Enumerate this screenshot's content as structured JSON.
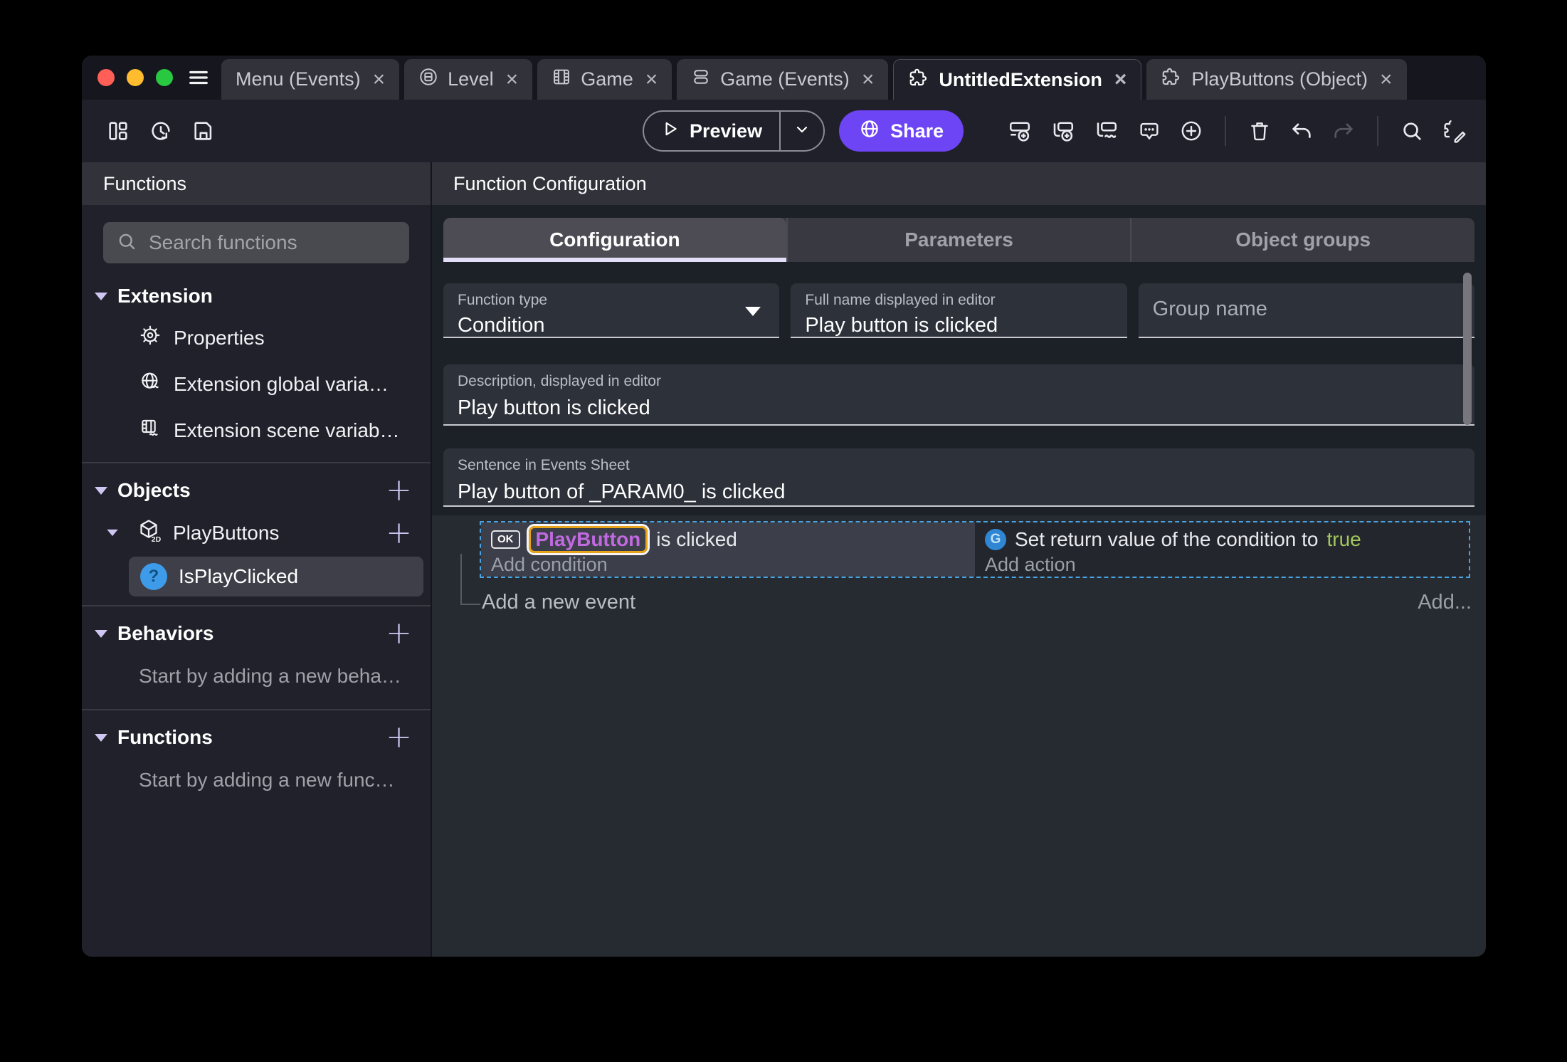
{
  "close_glyph": "×",
  "tabs": [
    {
      "label": "Menu (Events)"
    },
    {
      "label": "Level"
    },
    {
      "label": "Game"
    },
    {
      "label": "Game (Events)"
    },
    {
      "label": "UntitledExtension"
    },
    {
      "label": "PlayButtons (Object)"
    }
  ],
  "toolbar": {
    "preview": "Preview",
    "share": "Share"
  },
  "sidebar": {
    "title": "Functions",
    "search_placeholder": "Search functions",
    "extension_section": {
      "title": "Extension",
      "items": [
        "Properties",
        "Extension global varia…",
        "Extension scene variab…"
      ]
    },
    "objects_section": {
      "title": "Objects",
      "object_name": "PlayButtons",
      "function_name": "IsPlayClicked"
    },
    "behaviors_section": {
      "title": "Behaviors",
      "hint": "Start by adding a new beha…"
    },
    "functions_section": {
      "title": "Functions",
      "hint": "Start by adding a new func…"
    }
  },
  "main": {
    "title": "Function Configuration",
    "tabs": [
      {
        "label": "Configuration"
      },
      {
        "label": "Parameters"
      },
      {
        "label": "Object groups"
      }
    ],
    "function_type_label": "Function type",
    "function_type_value": "Condition",
    "full_name_label": "Full name displayed in editor",
    "full_name_value": "Play button is clicked",
    "group_name_placeholder": "Group name",
    "description_label": "Description, displayed in editor",
    "description_value": "Play button is clicked",
    "sentence_label": "Sentence in Events Sheet",
    "sentence_value": "Play button of _PARAM0_ is clicked"
  },
  "events": {
    "object_chip": "OK",
    "condition_object": "PlayButton",
    "condition_text": " is clicked",
    "add_condition": "Add condition",
    "action_text": "Set return value of the condition to ",
    "action_value": "true",
    "add_action": "Add action",
    "add_new_event": "Add a new event",
    "add_more": "Add..."
  },
  "colors": {
    "accent_purple": "#6d45f5",
    "lavender": "#cfc6f2",
    "tab_underline": "#e3def7",
    "event_selection_dashed": "#4aa3df",
    "object_ref_text": "#c069e0",
    "object_ref_border": "#e7a31a",
    "true_value_green": "#a3c75c",
    "traffic_red": "#ff5f57",
    "traffic_yellow": "#febc2e",
    "traffic_green": "#28c840"
  },
  "icons": {
    "tab_icons": [
      "scene-icon",
      "film-icon",
      "layers-icon",
      "puzzle-icon",
      "puzzle-icon"
    ],
    "toolbar_left": [
      "layout-icon",
      "history-icon",
      "save-icon"
    ],
    "toolbar_right": [
      "add-event-icon",
      "add-subevent-icon",
      "add-other-event-icon",
      "comment-icon",
      "circle-plus-icon",
      "trash-icon",
      "undo-icon",
      "redo-icon",
      "search-icon",
      "extension-edit-icon"
    ]
  }
}
